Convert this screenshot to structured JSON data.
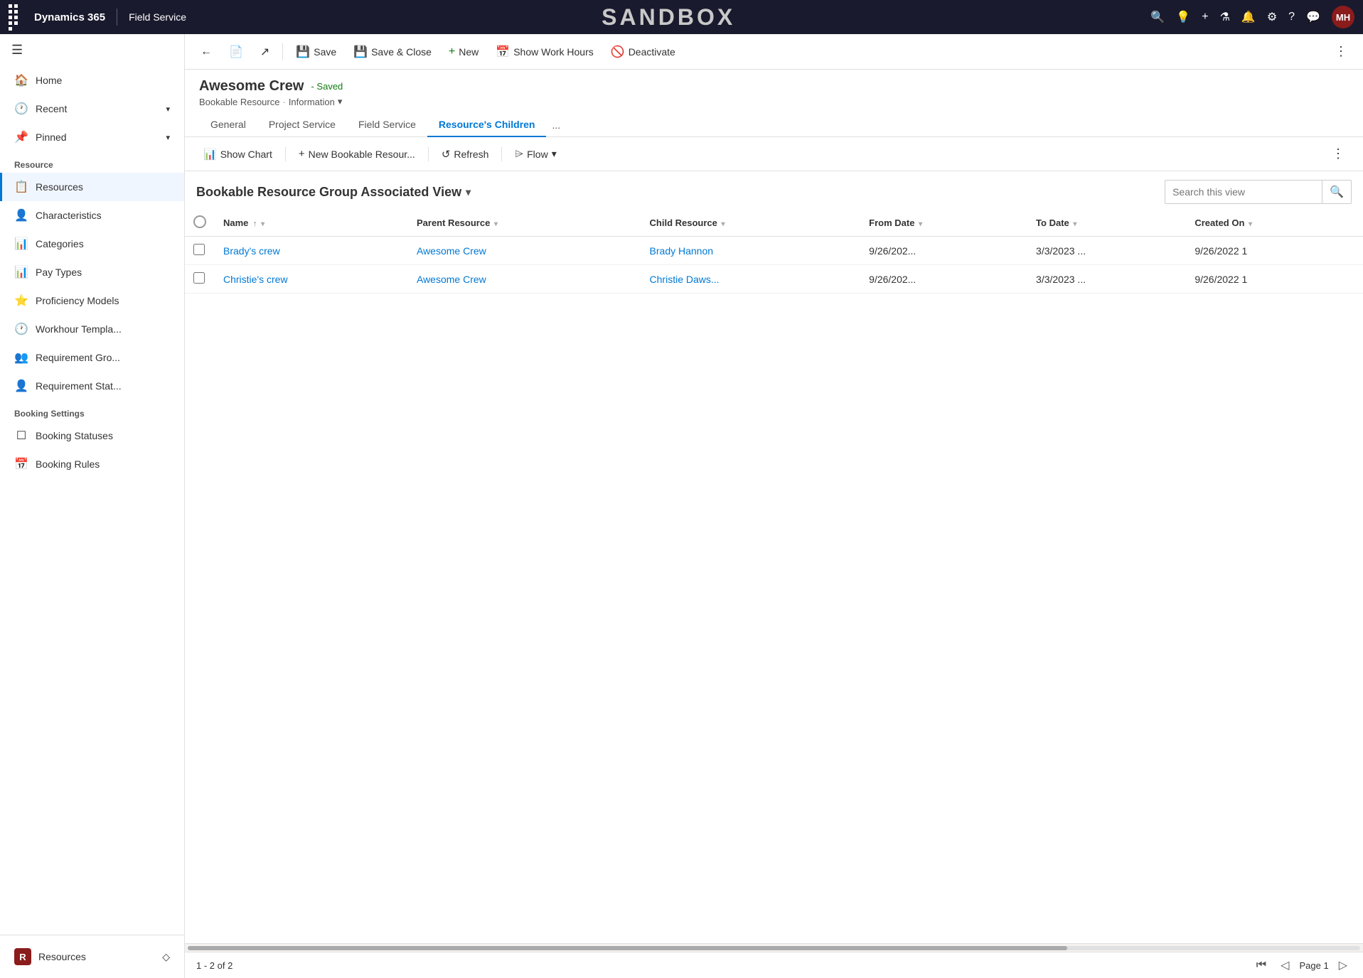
{
  "topnav": {
    "brand": "Dynamics 365",
    "module": "Field Service",
    "sandbox": "SANDBOX",
    "avatar_initials": "MH"
  },
  "sidebar": {
    "sections": [
      {
        "header": null,
        "items": [
          {
            "id": "home",
            "label": "Home",
            "icon": "🏠"
          },
          {
            "id": "recent",
            "label": "Recent",
            "icon": "🕐",
            "chevron": "▾"
          },
          {
            "id": "pinned",
            "label": "Pinned",
            "icon": "📌",
            "chevron": "▾"
          }
        ]
      },
      {
        "header": "Resource",
        "items": [
          {
            "id": "resources",
            "label": "Resources",
            "icon": "📋",
            "active": true
          },
          {
            "id": "characteristics",
            "label": "Characteristics",
            "icon": "👤"
          },
          {
            "id": "categories",
            "label": "Categories",
            "icon": "📊"
          },
          {
            "id": "pay-types",
            "label": "Pay Types",
            "icon": "📊"
          },
          {
            "id": "proficiency-models",
            "label": "Proficiency Models",
            "icon": "⭐"
          },
          {
            "id": "workhour-templates",
            "label": "Workhour Templa...",
            "icon": "🕐"
          },
          {
            "id": "requirement-gro",
            "label": "Requirement Gro...",
            "icon": "👥"
          },
          {
            "id": "requirement-stat",
            "label": "Requirement Stat...",
            "icon": "👤"
          }
        ]
      },
      {
        "header": "Booking Settings",
        "items": [
          {
            "id": "booking-statuses",
            "label": "Booking Statuses",
            "icon": "☐"
          },
          {
            "id": "booking-rules",
            "label": "Booking Rules",
            "icon": "📅"
          }
        ]
      }
    ],
    "bottom_item": {
      "label": "Resources",
      "avatar": "R"
    }
  },
  "toolbar": {
    "back_label": "←",
    "view_icon": "📄",
    "open_icon": "↗",
    "save_label": "Save",
    "save_icon": "💾",
    "save_close_label": "Save & Close",
    "save_close_icon": "💾",
    "new_label": "New",
    "new_icon": "+",
    "show_work_hours_label": "Show Work Hours",
    "show_work_hours_icon": "📅",
    "deactivate_label": "Deactivate",
    "deactivate_icon": "🚫",
    "more_icon": "⋮"
  },
  "page_header": {
    "title": "Awesome Crew",
    "saved_badge": "- Saved",
    "subtitle_resource": "Bookable Resource",
    "subtitle_sep": "·",
    "subtitle_info": "Information",
    "subtitle_chevron": "▾"
  },
  "tabs": [
    {
      "id": "general",
      "label": "General",
      "active": false
    },
    {
      "id": "project-service",
      "label": "Project Service",
      "active": false
    },
    {
      "id": "field-service",
      "label": "Field Service",
      "active": false
    },
    {
      "id": "resources-children",
      "label": "Resource's Children",
      "active": true
    }
  ],
  "tab_more": "...",
  "sub_toolbar": {
    "show_chart_label": "Show Chart",
    "show_chart_icon": "📊",
    "new_bookable_label": "New Bookable Resour...",
    "new_bookable_icon": "+",
    "refresh_label": "Refresh",
    "refresh_icon": "↺",
    "flow_label": "Flow",
    "flow_icon": "⌲",
    "flow_chevron": "▾",
    "more_icon": "⋮"
  },
  "view": {
    "title": "Bookable Resource Group Associated View",
    "title_chevron": "▾",
    "search_placeholder": "Search this view",
    "search_icon": "🔍"
  },
  "table": {
    "columns": [
      {
        "id": "checkbox",
        "label": "",
        "sort": false
      },
      {
        "id": "name",
        "label": "Name",
        "sort": "↑",
        "filter": "▾"
      },
      {
        "id": "parent-resource",
        "label": "Parent Resource",
        "sort": false,
        "filter": "▾"
      },
      {
        "id": "child-resource",
        "label": "Child Resource",
        "sort": false,
        "filter": "▾"
      },
      {
        "id": "from-date",
        "label": "From Date",
        "sort": false,
        "filter": "▾"
      },
      {
        "id": "to-date",
        "label": "To Date",
        "sort": false,
        "filter": "▾"
      },
      {
        "id": "created-on",
        "label": "Created On",
        "sort": false,
        "filter": "▾"
      }
    ],
    "rows": [
      {
        "name": "Brady's crew",
        "parent_resource": "Awesome Crew",
        "child_resource": "Brady Hannon",
        "from_date": "9/26/202...",
        "to_date": "3/3/2023 ...",
        "created_on": "9/26/2022 1"
      },
      {
        "name": "Christie's crew",
        "parent_resource": "Awesome Crew",
        "child_resource": "Christie Daws...",
        "from_date": "9/26/202...",
        "to_date": "3/3/2023 ...",
        "created_on": "9/26/2022 1"
      }
    ]
  },
  "footer": {
    "count": "1 - 2 of 2",
    "page_label": "Page 1",
    "first_icon": "|◁",
    "prev_icon": "◁",
    "next_icon": "▷"
  }
}
